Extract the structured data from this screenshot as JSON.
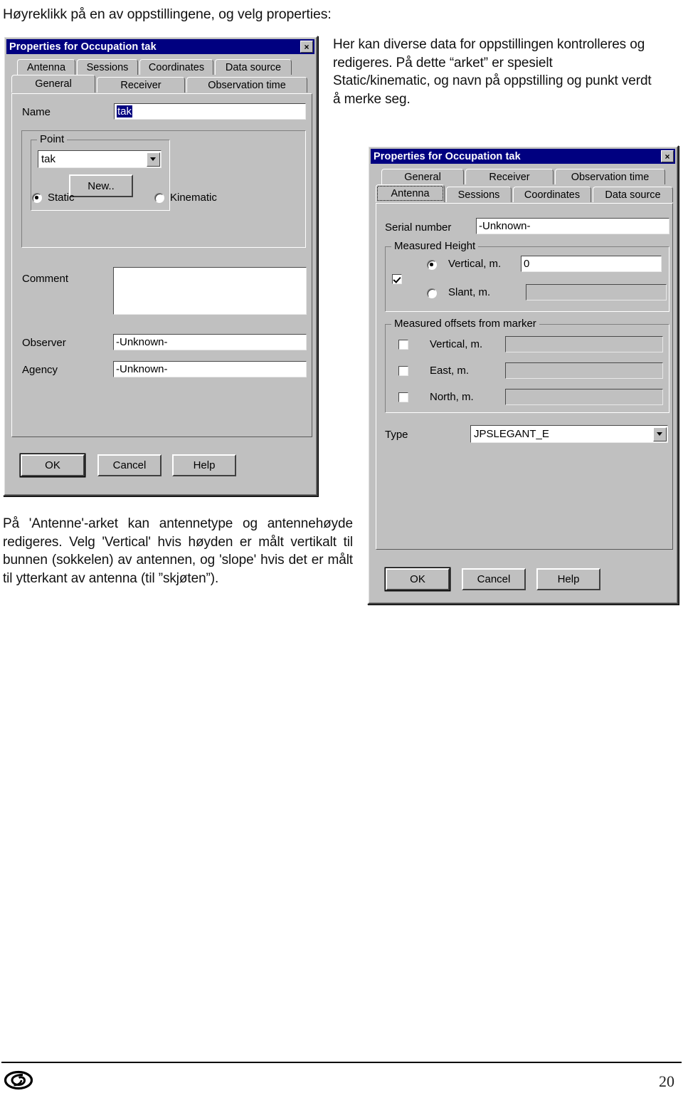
{
  "document": {
    "intro_line": "Høyreklikk på en av oppstillingene, og velg properties:",
    "note_right": "Her kan diverse data for oppstillingen kontrolleres og redigeres. På dette “arket” er spesielt Static/kinematic, og navn på oppstilling og punkt verdt å merke seg.",
    "note_left": "På 'Antenne'-arket kan antennetype og antennehøyde redigeres. Velg 'Vertical' hvis høyden er målt vertikalt til bunnen (sokkelen) av antennen, og 'slope' hvis det er målt til ytterkant av antenna (til ”skjøten”).",
    "page_number": "20"
  },
  "colors": {
    "titlebar": "#000080",
    "dialog_face": "#c0c0c0",
    "field_bg": "#ffffff",
    "selection": "#000080"
  },
  "dialog_general": {
    "title": "Properties for Occupation tak",
    "close_label": "×",
    "tabs_row_top": [
      {
        "label": "Antenna",
        "selected": false
      },
      {
        "label": "Sessions",
        "selected": false
      },
      {
        "label": "Coordinates",
        "selected": false
      },
      {
        "label": "Data source",
        "selected": false
      }
    ],
    "tabs_row_bottom": [
      {
        "label": "General",
        "selected": true
      },
      {
        "label": "Receiver",
        "selected": false
      },
      {
        "label": "Observation time",
        "selected": false
      }
    ],
    "name_label": "Name",
    "name_value": "tak",
    "point_group_title": "Point",
    "point_combo_value": "tak",
    "new_button": "New..",
    "static_label": "Static",
    "static_checked": true,
    "kinematic_label": "Kinematic",
    "kinematic_checked": false,
    "comment_label": "Comment",
    "comment_value": "",
    "observer_label": "Observer",
    "observer_value": "-Unknown-",
    "agency_label": "Agency",
    "agency_value": "-Unknown-",
    "buttons": {
      "ok": "OK",
      "cancel": "Cancel",
      "help": "Help"
    }
  },
  "dialog_antenna": {
    "title": "Properties for Occupation tak",
    "close_label": "×",
    "tabs_row_top": [
      {
        "label": "General",
        "selected": false
      },
      {
        "label": "Receiver",
        "selected": false
      },
      {
        "label": "Observation time",
        "selected": false
      }
    ],
    "tabs_row_bottom": [
      {
        "label": "Antenna",
        "selected": true
      },
      {
        "label": "Sessions",
        "selected": false
      },
      {
        "label": "Coordinates",
        "selected": false
      },
      {
        "label": "Data source",
        "selected": false
      }
    ],
    "serial_label": "Serial number",
    "serial_value": "-Unknown-",
    "measured_height_group": "Measured Height",
    "height_enabled": true,
    "vertical_label": "Vertical, m.",
    "vertical_selected": true,
    "vertical_value": "0",
    "slant_label": "Slant, m.",
    "slant_selected": false,
    "slant_value": "",
    "offsets_group": "Measured offsets from marker",
    "offsets": [
      {
        "label": "Vertical, m.",
        "checked": false,
        "value": ""
      },
      {
        "label": "East, m.",
        "checked": false,
        "value": ""
      },
      {
        "label": "North, m.",
        "checked": false,
        "value": ""
      }
    ],
    "type_label": "Type",
    "type_value": "JPSLEGANT_E",
    "buttons": {
      "ok": "OK",
      "cancel": "Cancel",
      "help": "Help"
    }
  }
}
